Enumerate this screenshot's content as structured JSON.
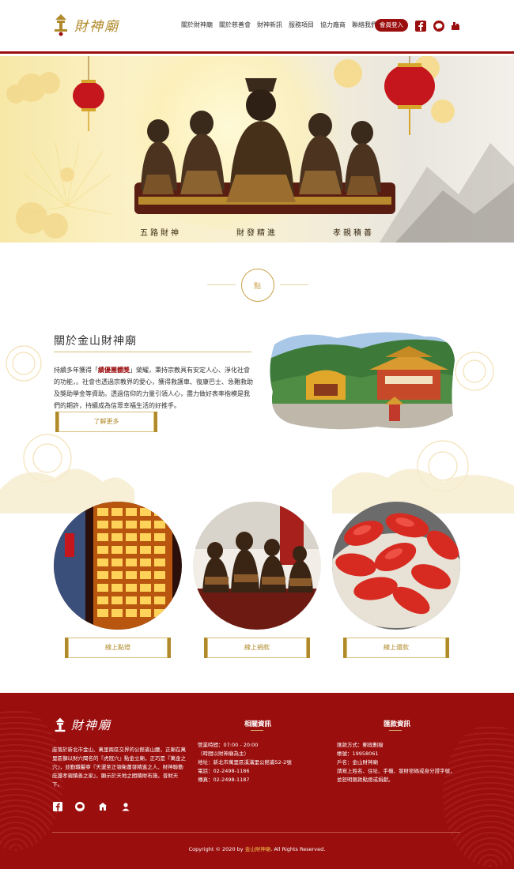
{
  "header": {
    "logo_text": "財神廟",
    "nav": [
      "關於財神廟",
      "關於慈善會",
      "財神新訊",
      "服務項目",
      "協力廠商",
      "聯絡我們"
    ],
    "login_label": "會員登入",
    "icons": [
      "facebook-icon",
      "line-icon",
      "temple-icon"
    ]
  },
  "hero": {
    "captions": [
      "五路財神",
      "財發精進",
      "孝親積善"
    ]
  },
  "ornament": {
    "char": "點"
  },
  "about": {
    "title": "關於金山財神廟",
    "text_before": "持續多年獲得「",
    "text_highlight": "績優團體獎",
    "text_after": "」榮耀，秉持宗教具有安定人心、淨化社會的功能，。社會也透過宗教界的愛心，獲得救護車、復康巴士、急難救助及獎助學金等資助。透過信仰的力量引領人心，盡力做好表率楷模是我們的期許，持續成為信眾幸福生活的好推手。",
    "more_label": "了解更多"
  },
  "services": [
    {
      "label": "線上點燈"
    },
    {
      "label": "線上捐款"
    },
    {
      "label": "線上還款"
    }
  ],
  "footer": {
    "logo_text": "財神廟",
    "description": "座落於新北市金山、萬里兩區交界的公館崙山腰，正廟在萬里區獅以財穴聞名的『虎冠穴』點金立廟，正巧是『萬金之穴』，並勤職鑿寧『天運至正領衛蕭發精進之人、財神聯動庇護孝親積善之家』，顯示於天地之間積財布施，普財天下。",
    "col1_title": "相關資訊",
    "col1_items": [
      "營業時間：07:00 - 20:00",
      "（時間以財神廟為主）",
      "地址：新北市萬里區溪滿里公館崙52-2號",
      "電話：02-2498-1186",
      "傳真：02-2498-1187"
    ],
    "col2_title": "匯款資訊",
    "col2_items": [
      "匯款方式：郵政劃撥",
      "帳號：19958061",
      "戶名：金山財神廟",
      "請寫上姓名、住址、手機、發財密碼或身分證字號，",
      "並恕明匯款點燈或捐獻。"
    ],
    "copyright_before": "Copyright © 2020 by ",
    "copyright_brand": "金山財神廟",
    "copyright_after": ". All Rights Reserved."
  },
  "colors": {
    "primary_red": "#9b0e0e",
    "gold": "#b08a2a",
    "light_gold": "#d9bd7a"
  }
}
